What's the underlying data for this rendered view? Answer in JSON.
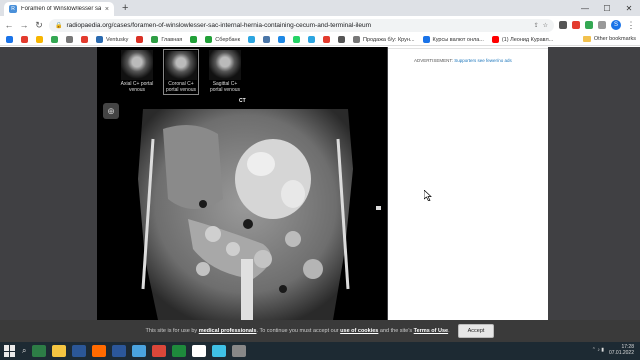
{
  "browser": {
    "tab_title": "Foramen of Winslow/lesser sac",
    "url": "radiopaedia.org/cases/foramen-of-winslowlesser-sac-internal-hernia-containing-cecum-and-terminal-ileum",
    "profile_initial": "S"
  },
  "bookmarks": {
    "items": [
      {
        "label": "",
        "color": "#1a73e8"
      },
      {
        "label": "",
        "color": "#e33b2e"
      },
      {
        "label": "",
        "color": "#f7b500"
      },
      {
        "label": "",
        "color": "#34a853"
      },
      {
        "label": "",
        "color": "#777777"
      },
      {
        "label": "",
        "color": "#e33b2e"
      },
      {
        "label": "Ventusky",
        "color": "#2a6ab0"
      },
      {
        "label": "",
        "color": "#d93025"
      },
      {
        "label": "Главная",
        "color": "#2f9e44"
      },
      {
        "label": "",
        "color": "#21a038"
      },
      {
        "label": "Сбербанк",
        "color": "#21a038"
      },
      {
        "label": "",
        "color": "#2ca5e0"
      },
      {
        "label": "",
        "color": "#4a76a8"
      },
      {
        "label": "",
        "color": "#1e88e5"
      },
      {
        "label": "",
        "color": "#25d366"
      },
      {
        "label": "",
        "color": "#2ca5e0"
      },
      {
        "label": "",
        "color": "#e33b2e"
      },
      {
        "label": "",
        "color": "#555555"
      },
      {
        "label": "Продажа б/у: Крун...",
        "color": "#777777"
      },
      {
        "label": "Курсы валют онла...",
        "color": "#1a73e8"
      },
      {
        "label": "(1) Леонид Куравл...",
        "color": "#ff0000"
      }
    ],
    "other": "Other bookmarks"
  },
  "viewer": {
    "thumbs": [
      {
        "label": "Axial C+ portal venous",
        "active": false
      },
      {
        "label": "Coronal C+ portal venous",
        "active": true
      },
      {
        "label": "Sagittal C+ portal venous",
        "active": false
      }
    ],
    "modality": "CT"
  },
  "ad": {
    "prefix": "ADVERTISEMENT: ",
    "link": "Supporters see fewer/no ads"
  },
  "cookie": {
    "t1": "This site is for use by ",
    "l1": "medical professionals",
    "t2": ". To continue you must accept our ",
    "l2": "use of cookies",
    "t3": " and the site's ",
    "l3": "Terms of Use",
    "t4": ".",
    "accept": "Accept"
  },
  "taskbar": {
    "apps": [
      "#2d7d46",
      "#f4c542",
      "#2b5797",
      "#ff6a00",
      "#2b579a",
      "#4aa3df",
      "#d9473a",
      "#1e8a3c",
      "#ffffff",
      "#3fc1e6",
      "#888888"
    ],
    "time": "17:28",
    "date": "07.01.2022"
  }
}
